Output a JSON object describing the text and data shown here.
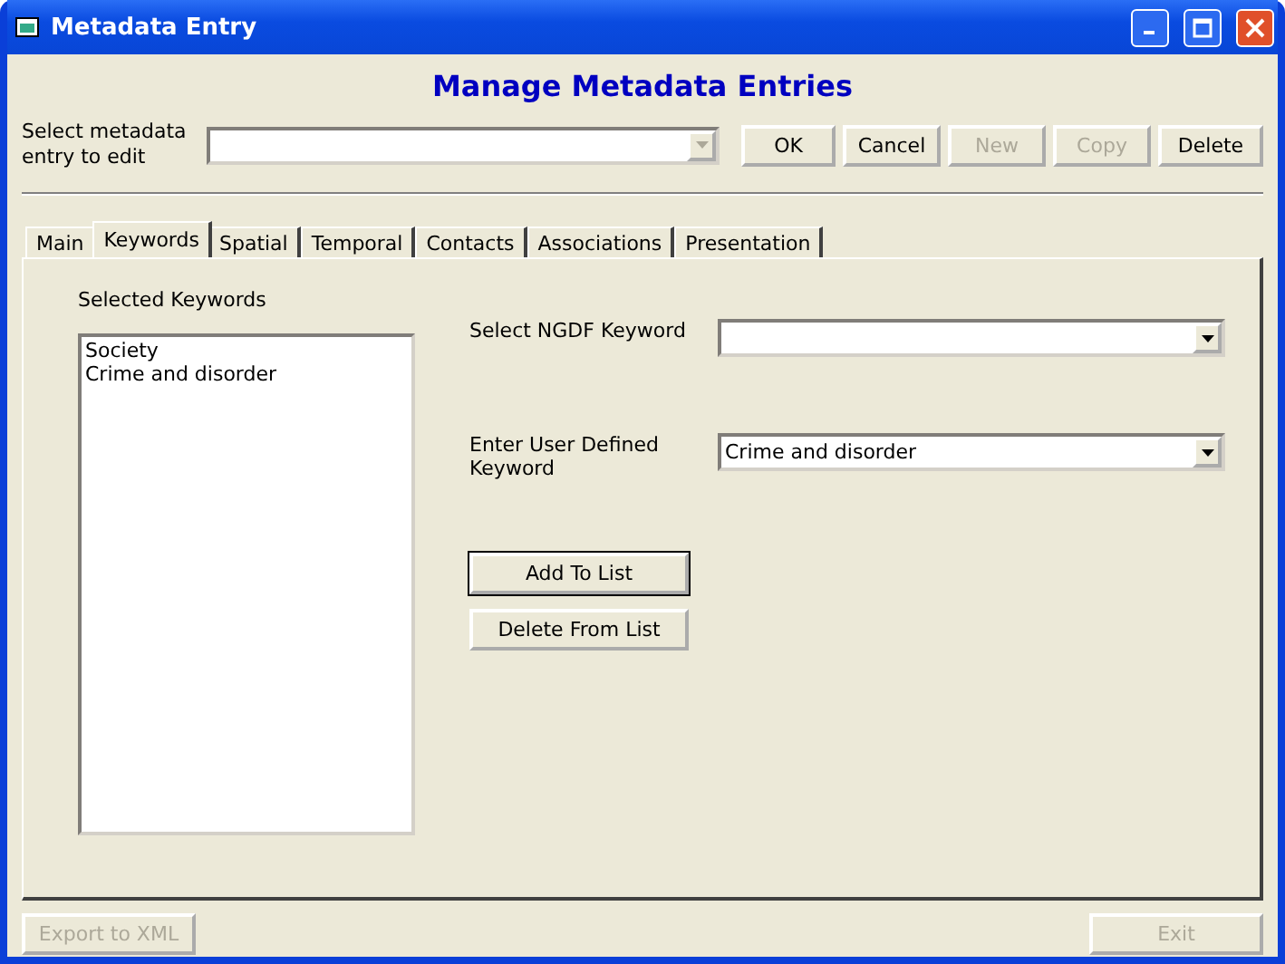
{
  "window": {
    "title": "Metadata Entry"
  },
  "heading": "Manage Metadata Entries",
  "entry_select": {
    "label": "Select metadata entry to edit"
  },
  "top_buttons": [
    {
      "label": "OK",
      "disabled": false
    },
    {
      "label": "Cancel",
      "disabled": false
    },
    {
      "label": "New",
      "disabled": true
    },
    {
      "label": "Copy",
      "disabled": true
    },
    {
      "label": "Delete",
      "disabled": false
    }
  ],
  "tabs": [
    {
      "label": "Main",
      "selected": false
    },
    {
      "label": "Keywords",
      "selected": true
    },
    {
      "label": "Spatial",
      "selected": false
    },
    {
      "label": "Temporal",
      "selected": false
    },
    {
      "label": "Contacts",
      "selected": false
    },
    {
      "label": "Associations",
      "selected": false
    },
    {
      "label": "Presentation",
      "selected": false
    }
  ],
  "keywords_panel": {
    "list_label": "Selected Keywords",
    "selected_keywords": [
      "Society",
      "Crime and disorder"
    ],
    "ngdf": {
      "label": "Select NGDF Keyword"
    },
    "user_defined": {
      "label": "Enter User Defined Keyword",
      "value": "Crime and disorder"
    },
    "buttons": [
      {
        "label": "Add To List",
        "focused": true
      },
      {
        "label": "Delete From List",
        "focused": false
      }
    ]
  },
  "bottom_buttons": [
    {
      "label": "Export to XML",
      "disabled": true
    },
    {
      "label": "Exit",
      "disabled": true
    }
  ]
}
